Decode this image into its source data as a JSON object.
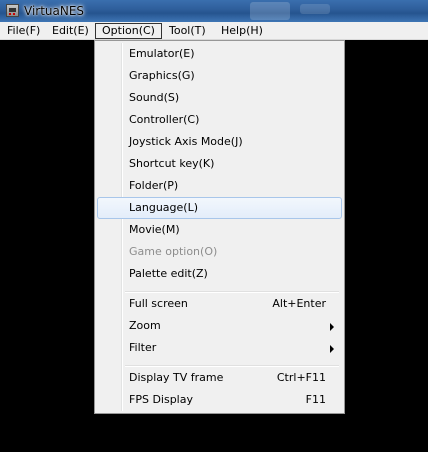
{
  "window": {
    "title": "VirtuaNES",
    "icon": "nes-console-icon"
  },
  "menubar": {
    "items": [
      {
        "label": "File(F)"
      },
      {
        "label": "Edit(E)"
      },
      {
        "label": "Option(C)",
        "active": true
      },
      {
        "label": "Tool(T)"
      },
      {
        "label": "Help(H)"
      }
    ]
  },
  "option_menu": {
    "items": [
      {
        "label": "Emulator(E)"
      },
      {
        "label": "Graphics(G)"
      },
      {
        "label": "Sound(S)"
      },
      {
        "label": "Controller(C)"
      },
      {
        "label": "Joystick Axis Mode(J)"
      },
      {
        "label": "Shortcut key(K)"
      },
      {
        "label": "Folder(P)"
      },
      {
        "label": "Language(L)",
        "highlighted": true
      },
      {
        "label": "Movie(M)"
      },
      {
        "label": "Game option(O)",
        "disabled": true
      },
      {
        "label": "Palette edit(Z)"
      },
      {
        "label": "Full screen",
        "shortcut": "Alt+Enter"
      },
      {
        "label": "Zoom",
        "submenu": true
      },
      {
        "label": "Filter",
        "submenu": true
      },
      {
        "label": "Display TV frame",
        "shortcut": "Ctrl+F11"
      },
      {
        "label": "FPS Display",
        "shortcut": "F11"
      }
    ]
  },
  "colors": {
    "titlebar": "#2f5f9c",
    "menu_background": "#f0f0f0",
    "highlight_border": "#a8c6ea",
    "disabled_text": "#8d8d8d",
    "emulator_screen": "#000000"
  }
}
